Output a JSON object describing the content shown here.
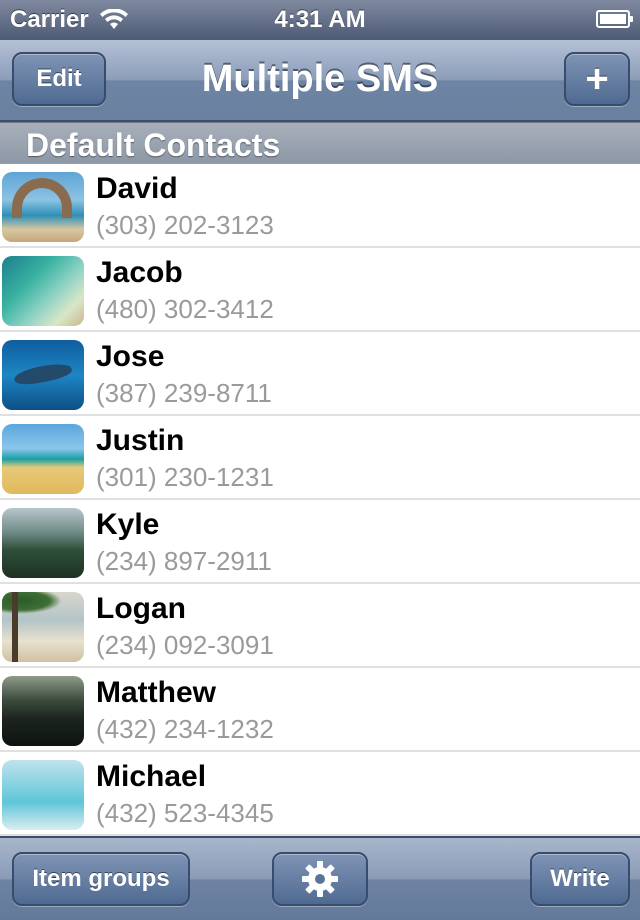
{
  "status_bar": {
    "carrier": "Carrier",
    "time": "4:31 AM",
    "battery_level": 1.0
  },
  "nav": {
    "title": "Multiple SMS",
    "edit_label": "Edit",
    "add_label": "+"
  },
  "section": {
    "title": "Default Contacts"
  },
  "contacts": [
    {
      "name": "David",
      "phone": "(303) 202-3123"
    },
    {
      "name": "Jacob",
      "phone": "(480) 302-3412"
    },
    {
      "name": "Jose",
      "phone": "(387) 239-8711"
    },
    {
      "name": "Justin",
      "phone": "(301) 230-1231"
    },
    {
      "name": "Kyle",
      "phone": "(234) 897-2911"
    },
    {
      "name": "Logan",
      "phone": "(234) 092-3091"
    },
    {
      "name": "Matthew",
      "phone": "(432) 234-1232"
    },
    {
      "name": "Michael",
      "phone": "(432) 523-4345"
    }
  ],
  "toolbar": {
    "groups_label": "Item groups",
    "settings_icon": "gear-icon",
    "write_label": "Write"
  },
  "colors": {
    "bar_blue": "#6e84a4",
    "phone_gray": "#9a9a9a"
  }
}
